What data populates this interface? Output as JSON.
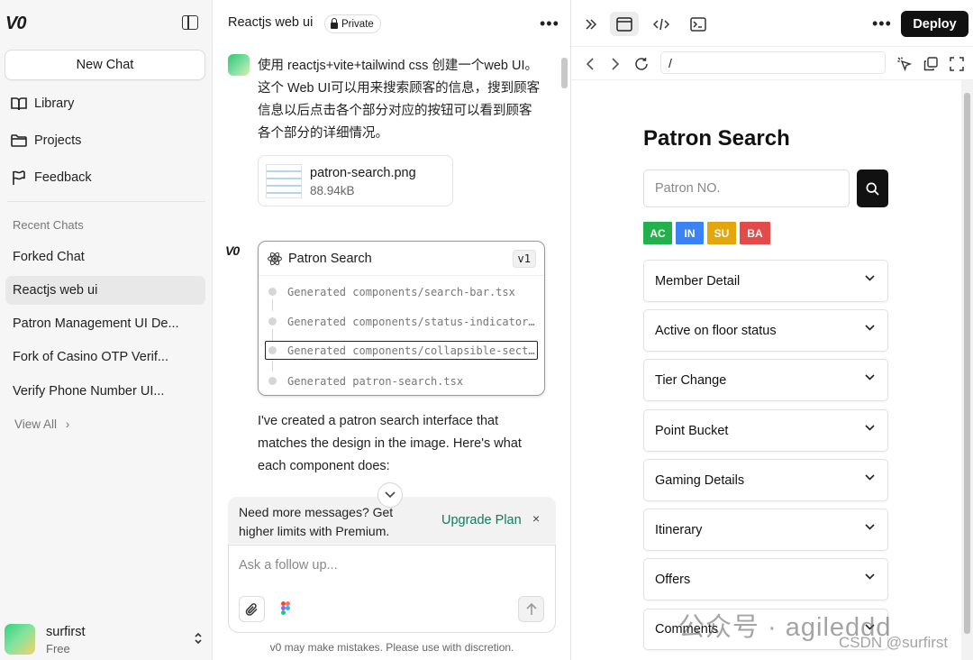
{
  "sidebar": {
    "logo": "V0",
    "new_chat": "New Chat",
    "nav": [
      {
        "label": "Library",
        "icon": "book-icon"
      },
      {
        "label": "Projects",
        "icon": "folder-icon"
      },
      {
        "label": "Feedback",
        "icon": "flag-icon"
      }
    ],
    "recent_label": "Recent Chats",
    "recent": [
      {
        "label": "Forked Chat",
        "active": false
      },
      {
        "label": "Reactjs web ui",
        "active": true
      },
      {
        "label": "Patron Management UI De...",
        "active": false
      },
      {
        "label": "Fork of Casino OTP Verif...",
        "active": false
      },
      {
        "label": "Verify Phone Number UI...",
        "active": false
      }
    ],
    "view_all": "View All",
    "user": {
      "name": "surfirst",
      "plan": "Free"
    }
  },
  "chat": {
    "title": "Reactjs web ui",
    "visibility": "Private",
    "user_message": "使用 reactjs+vite+tailwind css 创建一个web UI。这个 Web UI可以用来搜索顾客的信息，搜到顾客信息以后点击各个部分对应的按钮可以看到顾客各个部分的详细情况。",
    "attachment": {
      "name": "patron-search.png",
      "size": "88.94kB"
    },
    "assistant_logo": "V0",
    "generation": {
      "title": "Patron Search",
      "version": "v1",
      "steps": [
        "Generated components/search-bar.tsx",
        "Generated components/status-indicators.tsx",
        "Generated components/collapsible-section.tsx",
        "Generated patron-search.tsx"
      ]
    },
    "assistant_text": "I've created a patron search interface that matches the design in the image. Here's what each component does:",
    "upsell": {
      "text": "Need more messages? Get higher limits with Premium.",
      "link": "Upgrade Plan",
      "close": "×"
    },
    "composer_placeholder": "Ask a follow up...",
    "disclaimer": "v0 may make mistakes. Please use with discretion."
  },
  "preview": {
    "deploy": "Deploy",
    "url": "/",
    "title": "Patron Search",
    "search_placeholder": "Patron NO.",
    "statuses": [
      {
        "label": "AC",
        "color": "#22b14c"
      },
      {
        "label": "IN",
        "color": "#3b82f6"
      },
      {
        "label": "SU",
        "color": "#e2a70c"
      },
      {
        "label": "BA",
        "color": "#e34a4a"
      }
    ],
    "sections": [
      "Member Detail",
      "Active on floor status",
      "Tier Change",
      "Point Bucket",
      "Gaming Details",
      "Itinerary",
      "Offers",
      "Comments"
    ]
  },
  "watermark": {
    "main": "公众号 · agileddd",
    "sub": "CSDN @surfirst"
  }
}
